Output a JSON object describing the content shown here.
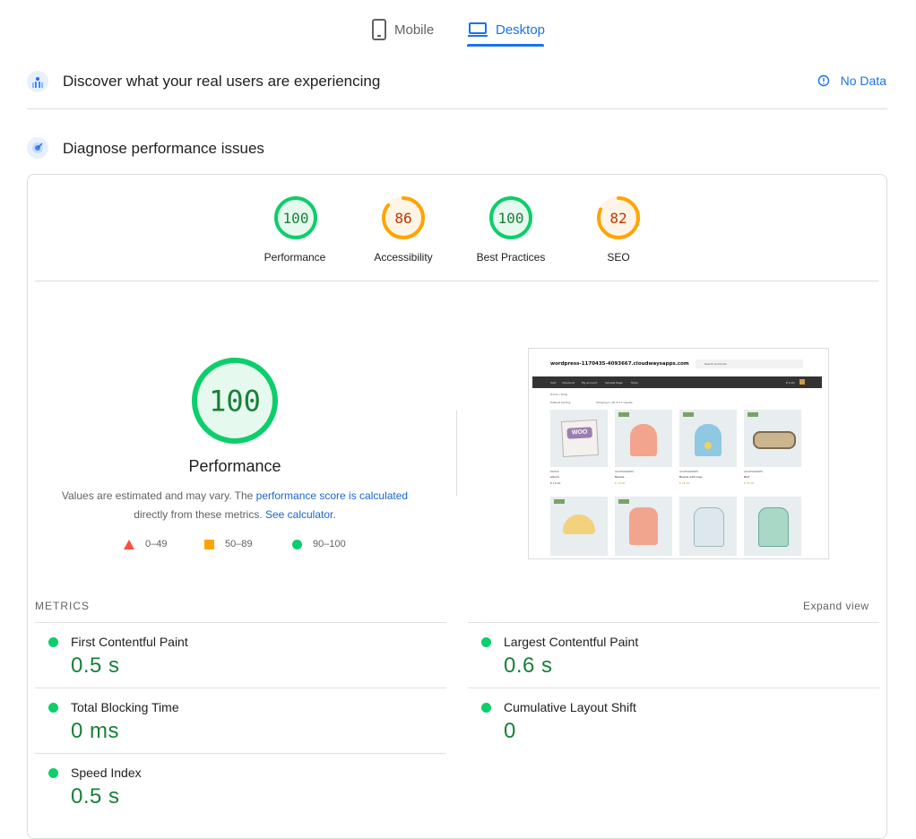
{
  "tabs": {
    "mobile": "Mobile",
    "desktop": "Desktop"
  },
  "field": {
    "title": "Discover what your real users are experiencing",
    "status": "No Data"
  },
  "lab": {
    "title": "Diagnose performance issues"
  },
  "scores": [
    {
      "value": "100",
      "label": "Performance",
      "color": "#0cce6b"
    },
    {
      "value": "86",
      "label": "Accessibility",
      "color": "#ffa400"
    },
    {
      "value": "100",
      "label": "Best Practices",
      "color": "#0cce6b"
    },
    {
      "value": "82",
      "label": "SEO",
      "color": "#ffa400"
    }
  ],
  "performance": {
    "score": "100",
    "label": "Performance",
    "desc_pre": "Values are estimated and may vary. The ",
    "desc_link": "performance score is calculated",
    "desc_mid": "directly from these metrics. ",
    "desc_link2": "See calculator."
  },
  "legend": {
    "fail": "0–49",
    "average": "50–89",
    "pass": "90–100"
  },
  "metrics_header": {
    "title": "METRICS",
    "expand": "Expand view"
  },
  "metrics": [
    {
      "name": "First Contentful Paint",
      "value": "0.5 s"
    },
    {
      "name": "Largest Contentful Paint",
      "value": "0.6 s"
    },
    {
      "name": "Total Blocking Time",
      "value": "0 ms"
    },
    {
      "name": "Cumulative Layout Shift",
      "value": "0"
    },
    {
      "name": "Speed Index",
      "value": "0.5 s"
    }
  ],
  "thumbnail": {
    "site": "wordpress-1170435-4093667.cloudwaysapps.com",
    "search_placeholder": "Search products…",
    "nav": [
      "Cart",
      "Checkout",
      "My account",
      "Sample Page",
      "Shop"
    ],
    "cart_total": "€ 0,00",
    "breadcrumb": "Home / Shop",
    "sorting": "Default sorting",
    "results": "Showing 1–16 of 17 results",
    "logo_text": "WOO",
    "products": [
      {
        "cat": "MUSIC",
        "name": "Album",
        "price": "€ 15,00"
      },
      {
        "cat": "ACCESSORIES",
        "name": "Beanie",
        "price": "€ 18,00"
      },
      {
        "cat": "ACCESSORIES",
        "name": "Beanie with Logo",
        "price": "€ 18,00"
      },
      {
        "cat": "ACCESSORIES",
        "name": "Belt",
        "price": "€ 55,00"
      }
    ]
  },
  "colors": {
    "accent": "#1a73e8",
    "pass": "#0cce6b",
    "average": "#ffa400",
    "fail": "#ff4e42"
  }
}
